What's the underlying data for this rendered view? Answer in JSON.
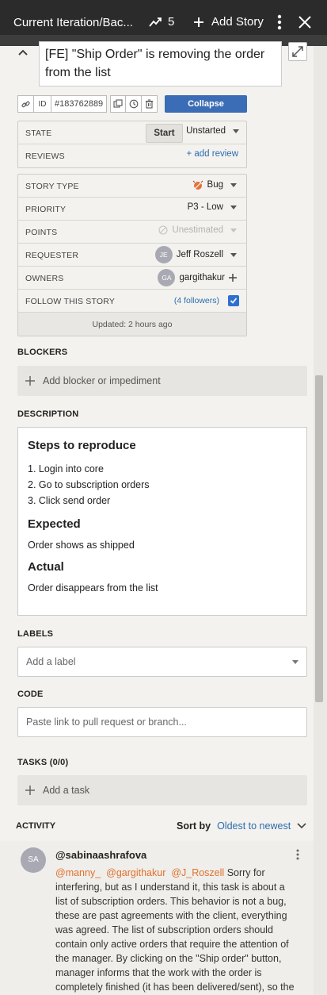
{
  "topbar": {
    "title": "Current Iteration/Bac...",
    "velocity": "5",
    "add_story": "Add Story"
  },
  "story": {
    "title": "[FE] \"Ship Order\" is removing the order from the list",
    "id_label": "ID",
    "id_value": "#183762889",
    "collapse": "Collapse"
  },
  "state_panel": {
    "state_label": "STATE",
    "start_button": "Start",
    "state_value": "Unstarted",
    "reviews_label": "REVIEWS",
    "add_review": "+ add review"
  },
  "details": {
    "story_type_label": "STORY TYPE",
    "story_type_value": "Bug",
    "priority_label": "PRIORITY",
    "priority_value": "P3 - Low",
    "points_label": "POINTS",
    "points_value": "Unestimated",
    "requester_label": "REQUESTER",
    "requester_initials": "JE",
    "requester_name": "Jeff Roszell",
    "owners_label": "OWNERS",
    "owner_initials": "GA",
    "owner_name": "gargithakur",
    "follow_label": "FOLLOW THIS STORY",
    "followers": "(4 followers)",
    "updated": "Updated: 2 hours ago"
  },
  "blockers": {
    "label": "BLOCKERS",
    "placeholder": "Add blocker or impediment"
  },
  "description": {
    "label": "DESCRIPTION",
    "h1": "Steps to reproduce",
    "steps": [
      "1. Login into core",
      "2. Go to subscription orders",
      "3. Click send order"
    ],
    "h2": "Expected",
    "expected": "Order shows as shipped",
    "h3": "Actual",
    "actual": "Order disappears from the list"
  },
  "labels": {
    "label": "LABELS",
    "placeholder": "Add a label"
  },
  "code": {
    "label": "CODE",
    "placeholder": "Paste link to pull request or branch..."
  },
  "tasks": {
    "label": "TASKS (0/0)",
    "placeholder": "Add a task"
  },
  "activity": {
    "label": "ACTIVITY",
    "sort_by": "Sort by",
    "sort_mode": "Oldest to newest",
    "comment": {
      "initials": "SA",
      "author": "@sabinaashrafova",
      "mentions": [
        "@manny_",
        "@gargithakur",
        "@J_Roszell"
      ],
      "text": "Sorry for interfering, but as I understand it, this task is about a list of subscription orders. This behavior is not a bug, these are past agreements with the client, everything was agreed. The list of subscription orders should contain only active orders that require the attention of the manager. By clicking on the \"Ship order\" button, manager informs that the work with the order is completely finished (it has been delivered/sent), so the"
    }
  },
  "colors": {
    "accent": "#3b6cb6",
    "link": "#2b6cb0",
    "mention": "#e1702d",
    "topbar": "#2b2b2b"
  }
}
